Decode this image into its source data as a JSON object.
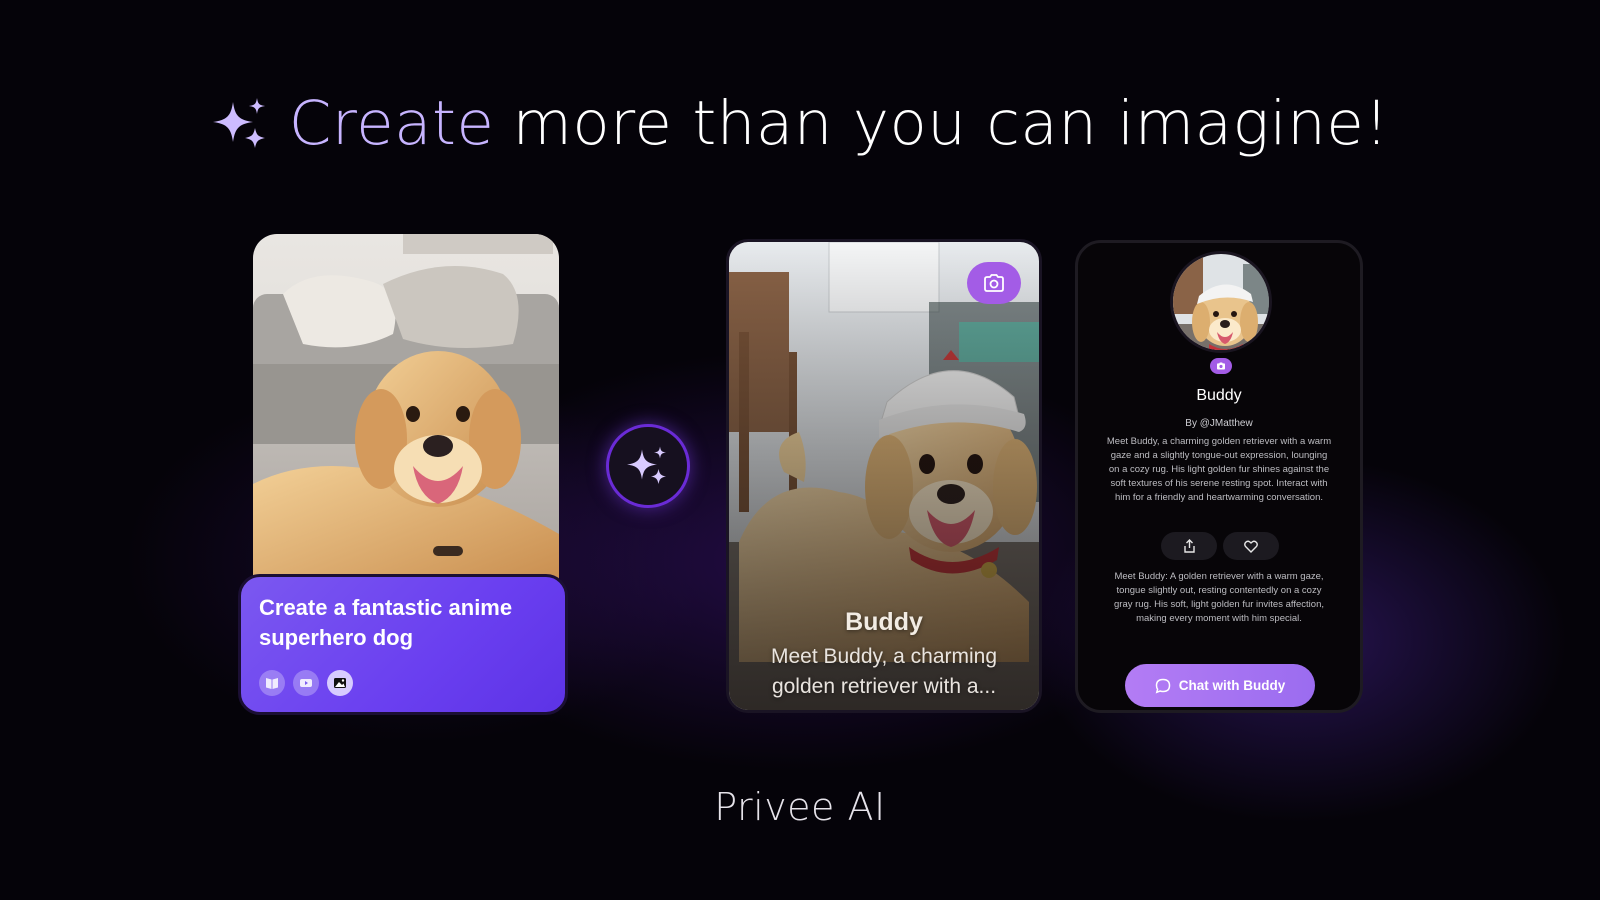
{
  "headline": {
    "accent": "Create",
    "rest": "more than you can imagine!",
    "icon": "sparkles-icon"
  },
  "prompt_card": {
    "text": "Create a fantastic anime superhero dog",
    "icons": [
      "book-icon",
      "video-icon",
      "image-icon"
    ],
    "active_icon": "image-icon"
  },
  "magic": {
    "icon": "sparkles-icon"
  },
  "anime_card": {
    "name": "Buddy",
    "description": "Meet Buddy, a charming golden retriever with a...",
    "icon": "camera-icon"
  },
  "profile": {
    "name": "Buddy",
    "by": "By @JMatthew",
    "description": "Meet Buddy, a charming golden retriever with a warm gaze and a slightly tongue-out expression, lounging on a cozy rug. His light golden fur shines against the soft textures of his serene resting spot. Interact with him for a friendly and heartwarming conversation.",
    "description2": "Meet Buddy: A golden retriever with a warm gaze, tongue slightly out, resting contentedly on a cozy gray rug. His soft, light golden fur invites affection, making every moment with him special.",
    "chat_label": "Chat with Buddy",
    "actions": [
      "share-icon",
      "heart-icon"
    ]
  },
  "brand": "Privee AI",
  "colors": {
    "background": "#050309",
    "accent": "#c7b4ff",
    "prompt_card": "#6a3ff0",
    "chat_button": "#a97af3"
  }
}
